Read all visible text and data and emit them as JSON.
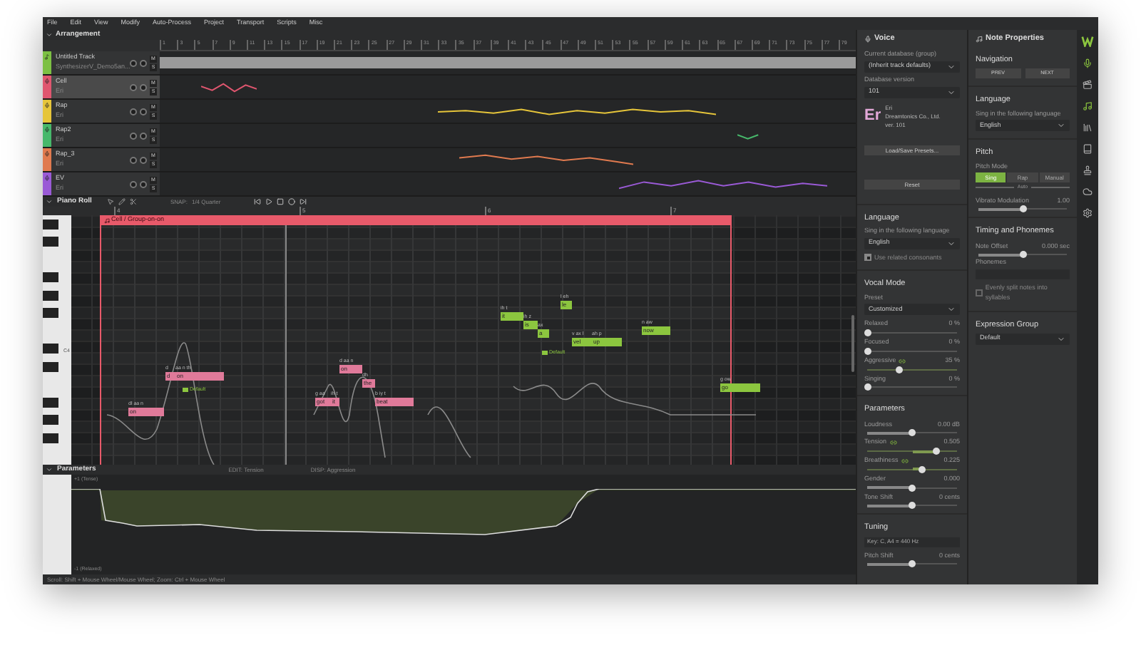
{
  "menu": [
    "File",
    "Edit",
    "View",
    "Modify",
    "Auto-Process",
    "Project",
    "Transport",
    "Scripts",
    "Misc"
  ],
  "arrangement": {
    "title": "Arrangement",
    "bars": [
      "1",
      "3",
      "5",
      "7",
      "9",
      "11",
      "13",
      "15",
      "17",
      "19",
      "21",
      "23",
      "25",
      "27",
      "29",
      "31",
      "33",
      "35",
      "37",
      "39",
      "41",
      "43",
      "45",
      "47",
      "49",
      "51",
      "53",
      "55",
      "57",
      "59",
      "61",
      "63",
      "65",
      "67",
      "69",
      "71",
      "73",
      "75",
      "77",
      "79"
    ],
    "tracks": [
      {
        "name": "Untitled Track",
        "sub": "SynthesizerV_Demo5an...",
        "color": "#7cc043",
        "selected": false,
        "kind": "audio",
        "buttons": [
          "M",
          "S"
        ]
      },
      {
        "name": "Cell",
        "sub": "Eri",
        "color": "#e0566f",
        "selected": true,
        "kind": "vocal",
        "buttons": [
          "M",
          "S"
        ]
      },
      {
        "name": "Rap",
        "sub": "Eri",
        "color": "#e6c53a",
        "selected": false,
        "kind": "vocal",
        "buttons": [
          "M",
          "S"
        ]
      },
      {
        "name": "Rap2",
        "sub": "Eri",
        "color": "#47b86b",
        "selected": false,
        "kind": "vocal",
        "buttons": [
          "M",
          "S"
        ]
      },
      {
        "name": "Rap_3",
        "sub": "Eri",
        "color": "#e07a4f",
        "selected": false,
        "kind": "vocal",
        "buttons": [
          "M",
          "S"
        ]
      },
      {
        "name": "EV",
        "sub": "Eri",
        "color": "#9a5ad6",
        "selected": false,
        "kind": "vocal",
        "buttons": [
          "M",
          "S"
        ]
      }
    ]
  },
  "piano_roll": {
    "title": "Piano Roll",
    "snap_label": "SNAP:",
    "snap": "1/4 Quarter",
    "bars": [
      "4",
      "5",
      "6",
      "7"
    ],
    "group": "Cell / Group-on-on",
    "key_label": "C4",
    "notes": [
      {
        "lyric": "on",
        "phonemes": "dl aa n",
        "color": "#e07a9a"
      },
      {
        "lyric": "d",
        "phonemes": "d",
        "color": "#e07a9a"
      },
      {
        "lyric": "on",
        "phonemes": "aa n th",
        "color": "#e07a9a"
      },
      {
        "lyric": "got",
        "phonemes": "g aa",
        "color": "#e07a9a"
      },
      {
        "lyric": "it",
        "phonemes": "ih t",
        "color": "#e07a9a"
      },
      {
        "lyric": "on",
        "phonemes": "d aa n",
        "color": "#e07a9a"
      },
      {
        "lyric": "the",
        "phonemes": "dh",
        "color": "#e07a9a"
      },
      {
        "lyric": "beat",
        "phonemes": "b iy t",
        "color": "#e07a9a"
      },
      {
        "lyric": "it",
        "phonemes": "ih t",
        "color": "#8cc63f"
      },
      {
        "lyric": "is",
        "phonemes": "ih z",
        "color": "#8cc63f"
      },
      {
        "lyric": "a",
        "phonemes": "ax",
        "color": "#8cc63f"
      },
      {
        "lyric": "le",
        "phonemes": "l eh",
        "color": "#8cc63f"
      },
      {
        "lyric": "vel",
        "phonemes": "v ax l",
        "color": "#8cc63f"
      },
      {
        "lyric": "up",
        "phonemes": "ah p",
        "color": "#8cc63f"
      },
      {
        "lyric": "now",
        "phonemes": "n aw",
        "color": "#8cc63f"
      },
      {
        "lyric": "go",
        "phonemes": "g ow",
        "color": "#8cc63f"
      }
    ],
    "tags": [
      "Default",
      "Default"
    ]
  },
  "parameters": {
    "title": "Parameters",
    "edit": "EDIT:  Tension",
    "disp": "DISP:  Aggression",
    "top_label": "+1 (Tense)",
    "bottom_label": "-1 (Relaxed)"
  },
  "status_bar": "Scroll: Shift + Mouse Wheel/Mouse Wheel; Zoom: Ctrl + Mouse Wheel",
  "voice": {
    "title": "Voice",
    "db_label": "Current database (group)",
    "db": "(Inherit track defaults)",
    "version_label": "Database version",
    "version": "101",
    "logo": "Er",
    "voice_name": "Eri",
    "vendor": "Dreamtonics Co., Ltd.",
    "voice_ver": "ver. 101",
    "presets_button": "Load/Save Presets...",
    "reset_button": "Reset",
    "language_title": "Language",
    "language_label": "Sing in the following language",
    "language": "English",
    "consonants": {
      "label": "Use related consonants",
      "checked": true
    },
    "vocal_mode_title": "Vocal Mode",
    "preset_label": "Preset",
    "preset": "Customized",
    "modes": [
      {
        "label": "Relaxed",
        "value": "0 %",
        "level": 0,
        "linked": false
      },
      {
        "label": "Focused",
        "value": "0 %",
        "level": 0,
        "linked": false
      },
      {
        "label": "Aggressive",
        "value": "35 %",
        "level": 0.35,
        "linked": true
      },
      {
        "label": "Singing",
        "value": "0 %",
        "level": 0,
        "linked": false
      }
    ],
    "parameters_title": "Parameters",
    "parameters": [
      {
        "label": "Loudness",
        "value": "0.00 dB",
        "level": 0.5,
        "linked": false
      },
      {
        "label": "Tension",
        "value": "0.505",
        "level": 0.77,
        "linked": true
      },
      {
        "label": "Breathiness",
        "value": "0.225",
        "level": 0.61,
        "linked": true
      },
      {
        "label": "Gender",
        "value": "0.000",
        "level": 0.5,
        "linked": false
      },
      {
        "label": "Tone Shift",
        "value": "0 cents",
        "level": 0.5,
        "linked": false
      }
    ],
    "tuning_title": "Tuning",
    "tuning": "Key: C, A4 = 440 Hz",
    "pitch_shift": {
      "label": "Pitch Shift",
      "value": "0 cents",
      "level": 0.5,
      "linked": false
    }
  },
  "note_properties": {
    "title": "Note Properties",
    "navigation_title": "Navigation",
    "nav_buttons": [
      "PREV",
      "NEXT"
    ],
    "language_title": "Language",
    "language_label": "Sing in the following language",
    "language": "English",
    "pitch_title": "Pitch",
    "pitch_mode_label": "Pitch Mode",
    "pitch_modes": [
      {
        "label": "Sing",
        "selected": true
      },
      {
        "label": "Rap",
        "selected": false
      },
      {
        "label": "Manual",
        "selected": false
      }
    ],
    "auto_label": "Auto",
    "vibrato": {
      "label": "Vibrato Modulation",
      "value": "1.00",
      "level": 0.5,
      "linked": false
    },
    "timing_title": "Timing and Phonemes",
    "note_offset": {
      "label": "Note Offset",
      "value": "0.000 sec",
      "level": 0.5,
      "linked": false
    },
    "phonemes_label": "Phonemes",
    "split": {
      "label": "Evenly split notes into syllables",
      "checked": false
    },
    "expression_title": "Expression Group",
    "expression": "Default"
  },
  "sidebar_icons": [
    {
      "kind": "logo",
      "selected": false
    },
    {
      "kind": "mic",
      "selected": true
    },
    {
      "kind": "film",
      "selected": false
    },
    {
      "kind": "note",
      "selected": true
    },
    {
      "kind": "library",
      "selected": false
    },
    {
      "kind": "book",
      "selected": false
    },
    {
      "kind": "stamp",
      "selected": false
    },
    {
      "kind": "cloud",
      "selected": false
    },
    {
      "kind": "settings",
      "selected": false
    }
  ]
}
